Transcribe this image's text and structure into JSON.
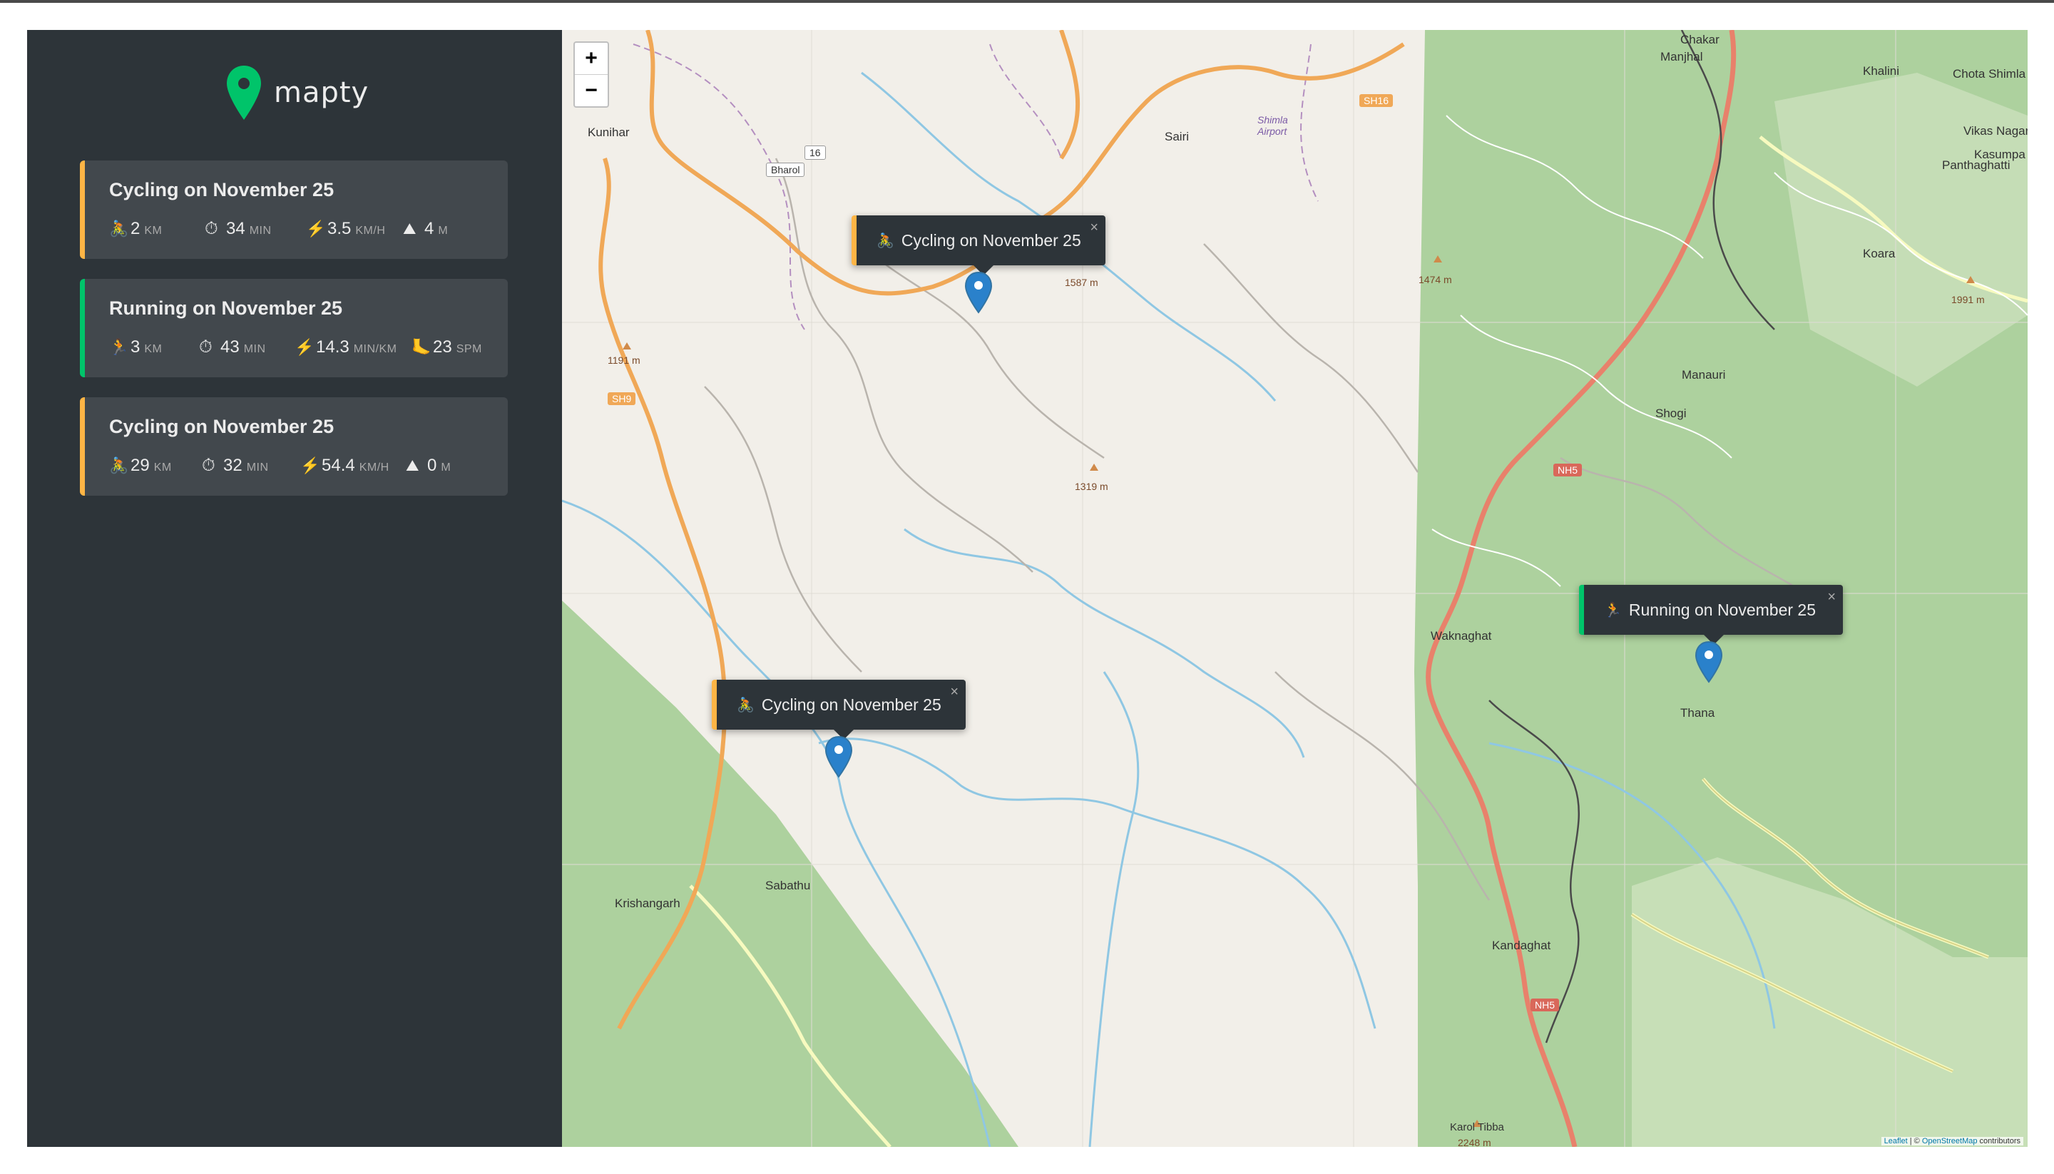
{
  "app": {
    "name": "mapty",
    "logo_icon": "map-pin-icon"
  },
  "workouts": [
    {
      "type": "cycling",
      "title": "Cycling on November 25",
      "distance": {
        "icon": "🚴",
        "value": "2",
        "unit": "km"
      },
      "duration": {
        "icon": "⏱",
        "value": "34",
        "unit": "min"
      },
      "speed": {
        "icon": "⚡",
        "value": "3.5",
        "unit": "km/h"
      },
      "elevation": {
        "icon": "⛰",
        "value": "4",
        "unit": "m"
      }
    },
    {
      "type": "running",
      "title": "Running on November 25",
      "distance": {
        "icon": "🏃",
        "value": "3",
        "unit": "km"
      },
      "duration": {
        "icon": "⏱",
        "value": "43",
        "unit": "min"
      },
      "pace": {
        "icon": "⚡",
        "value": "14.3",
        "unit": "min/km"
      },
      "cadence": {
        "icon": "🦶",
        "value": "23",
        "unit": "spm"
      }
    },
    {
      "type": "cycling",
      "title": "Cycling on November 25",
      "distance": {
        "icon": "🚴",
        "value": "29",
        "unit": "km"
      },
      "duration": {
        "icon": "⏱",
        "value": "32",
        "unit": "min"
      },
      "speed": {
        "icon": "⚡",
        "value": "54.4",
        "unit": "km/h"
      },
      "elevation": {
        "icon": "⛰",
        "value": "0",
        "unit": "m"
      }
    }
  ],
  "map": {
    "zoom_in": "+",
    "zoom_out": "−",
    "attribution": {
      "leaflet": "Leaflet",
      "separator": " | © ",
      "osm": "OpenStreetMap",
      "suffix": " contributors"
    },
    "popups": [
      {
        "type": "cycling",
        "icon": "🚴",
        "text": "Cycling on November 25",
        "close": "×"
      },
      {
        "type": "cycling",
        "icon": "🚴",
        "text": "Cycling on November 25",
        "close": "×"
      },
      {
        "type": "running",
        "icon": "🏃",
        "text": "Running on November 25",
        "close": "×"
      }
    ],
    "places": [
      "Kunihar",
      "Bharol",
      "Sairi",
      "Shimla Airport",
      "Manjhal",
      "Chakar",
      "Khalini",
      "Chota Shimla",
      "Vikas Nagar",
      "Kasumpa",
      "Panthaghatti",
      "Koara",
      "Manauri",
      "Shogi",
      "Waknaghat",
      "Thana",
      "Sabathu",
      "Krishangarh",
      "Kandaghat",
      "Karol Tibba"
    ],
    "elevations": [
      "1587 m",
      "1191 m",
      "1319 m",
      "1474 m",
      "1991 m",
      "2248 m"
    ],
    "roads": [
      "SH16",
      "SH9",
      "NH5",
      "NH5",
      "16"
    ]
  },
  "colors": {
    "cycling": "#ffb545",
    "running": "#00c46a",
    "sidebar": "#2d3439",
    "card": "#42484d",
    "marker": "#2a81cb"
  }
}
